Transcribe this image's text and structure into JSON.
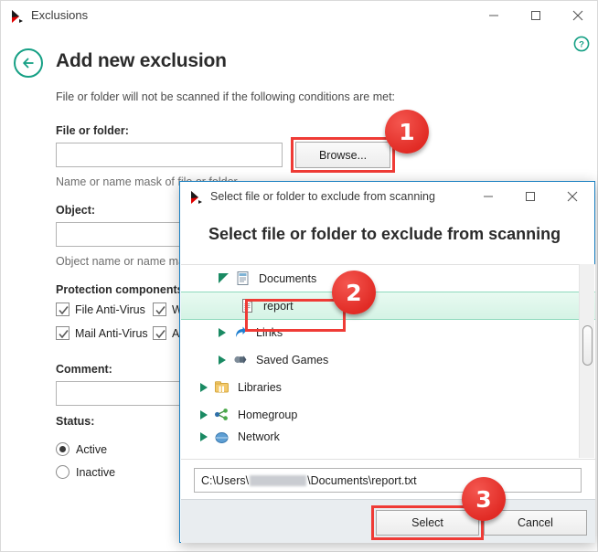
{
  "main_window": {
    "titlebar": {
      "icon": "kaspersky-logo-icon",
      "title": "Exclusions",
      "minimize": "—",
      "maximize": "□",
      "close": "✕"
    },
    "help_icon": "help-question-icon",
    "back_icon": "back-arrow-icon",
    "page_title": "Add new exclusion",
    "page_subtitle": "File or folder will not be scanned if the following conditions are met:",
    "fields": {
      "file_label": "File or folder:",
      "file_value": "",
      "file_hint": "Name or name mask of file or folder",
      "object_label": "Object:",
      "object_value": "",
      "object_hint": "Object name or name mask",
      "comment_label": "Comment:",
      "comment_value": "",
      "browse_label": "Browse..."
    },
    "protection": {
      "label": "Protection components:",
      "items": [
        {
          "label": "File Anti-Virus",
          "checked": true
        },
        {
          "label": "W",
          "checked": true
        },
        {
          "label": "Mail Anti-Virus",
          "checked": true
        },
        {
          "label": "A",
          "checked": true
        }
      ]
    },
    "status": {
      "label": "Status:",
      "options": [
        {
          "label": "Active",
          "selected": true
        },
        {
          "label": "Inactive",
          "selected": false
        }
      ]
    }
  },
  "dialog": {
    "titlebar": {
      "icon": "kaspersky-logo-icon",
      "title": "Select file or folder to exclude from scanning",
      "minimize": "—",
      "maximize": "□",
      "close": "✕"
    },
    "heading": "Select file or folder to exclude from scanning",
    "tree": [
      {
        "label": "Documents",
        "icon": "documents-folder-icon",
        "state": "expanded",
        "indent": 0,
        "selected": false
      },
      {
        "label": "report",
        "icon": "text-file-icon",
        "state": "leaf",
        "indent": 1,
        "selected": true
      },
      {
        "label": "Links",
        "icon": "links-folder-icon",
        "state": "collapsed",
        "indent": 0,
        "selected": false
      },
      {
        "label": "Saved Games",
        "icon": "saved-games-folder-icon",
        "state": "collapsed",
        "indent": 0,
        "selected": false
      },
      {
        "label": "Libraries",
        "icon": "libraries-folder-icon",
        "state": "collapsed",
        "indent": -1,
        "selected": false
      },
      {
        "label": "Homegroup",
        "icon": "homegroup-icon",
        "state": "collapsed",
        "indent": -1,
        "selected": false
      },
      {
        "label": "Network",
        "icon": "network-icon",
        "state": "collapsed",
        "indent": -1,
        "selected": false
      }
    ],
    "path": {
      "prefix": "C:\\Users\\",
      "redacted": "",
      "suffix": "\\Documents\\report.txt"
    },
    "buttons": {
      "select": "Select",
      "cancel": "Cancel"
    }
  },
  "callouts": [
    {
      "number": "1",
      "target": "browse-button"
    },
    {
      "number": "2",
      "target": "report-tree-item"
    },
    {
      "number": "3",
      "target": "select-button"
    }
  ],
  "colors": {
    "accent_teal": "#16a085",
    "callout_red": "#e12b25",
    "highlight_border": "#ef3b36",
    "selection_green": "#d5f3e5",
    "dialog_border": "#1a7fc1"
  }
}
